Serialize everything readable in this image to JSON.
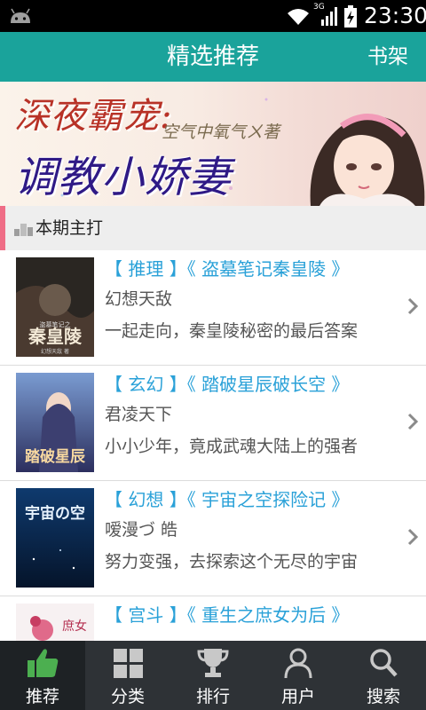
{
  "status_bar": {
    "network": "3G",
    "time": "23:30"
  },
  "header": {
    "title": "精选推荐",
    "shelf_label": "书架"
  },
  "banner": {
    "title_line1": "深夜霸宠:",
    "author_line": "空气中氧气ㄨ著",
    "title_line2": "调教小娇妻"
  },
  "section": {
    "label": "本期主打"
  },
  "books": [
    {
      "tag": "【 推理 】《 盗墓笔记秦皇陵 》",
      "author": "幻想天敌",
      "desc": "一起走向，秦皇陵秘密的最后答案",
      "cover_text": "秦皇陵",
      "cover_sub": "盗墓笔记之",
      "cover_author": "幻想天敌 著"
    },
    {
      "tag": "【 玄幻 】《 踏破星辰破长空 》",
      "author": "君凌天下",
      "desc": "小小少年，竟成武魂大陆上的强者",
      "cover_text": "踏破星辰"
    },
    {
      "tag": "【 幻想 】《 宇宙之空探险记 》",
      "author": "嗳漫づ 皓",
      "desc": "努力变强，去探索这个无尽的宇宙",
      "cover_text": "宇宙の空"
    },
    {
      "tag": "【 宫斗 】《 重生之庶女为后 》",
      "author": "",
      "desc": "",
      "cover_text": "庶女"
    }
  ],
  "bottom_nav": [
    {
      "label": "推荐",
      "icon": "thumbs-up-icon",
      "active": true
    },
    {
      "label": "分类",
      "icon": "grid-icon",
      "active": false
    },
    {
      "label": "排行",
      "icon": "trophy-icon",
      "active": false
    },
    {
      "label": "用户",
      "icon": "user-icon",
      "active": false
    },
    {
      "label": "搜索",
      "icon": "search-icon",
      "active": false
    }
  ],
  "colors": {
    "title_bar": "#1aa39b",
    "tag_text": "#2aa1d8",
    "section_accent": "#ef6d86",
    "nav_bg": "#2e3236",
    "nav_active_icon": "#4caf50"
  }
}
